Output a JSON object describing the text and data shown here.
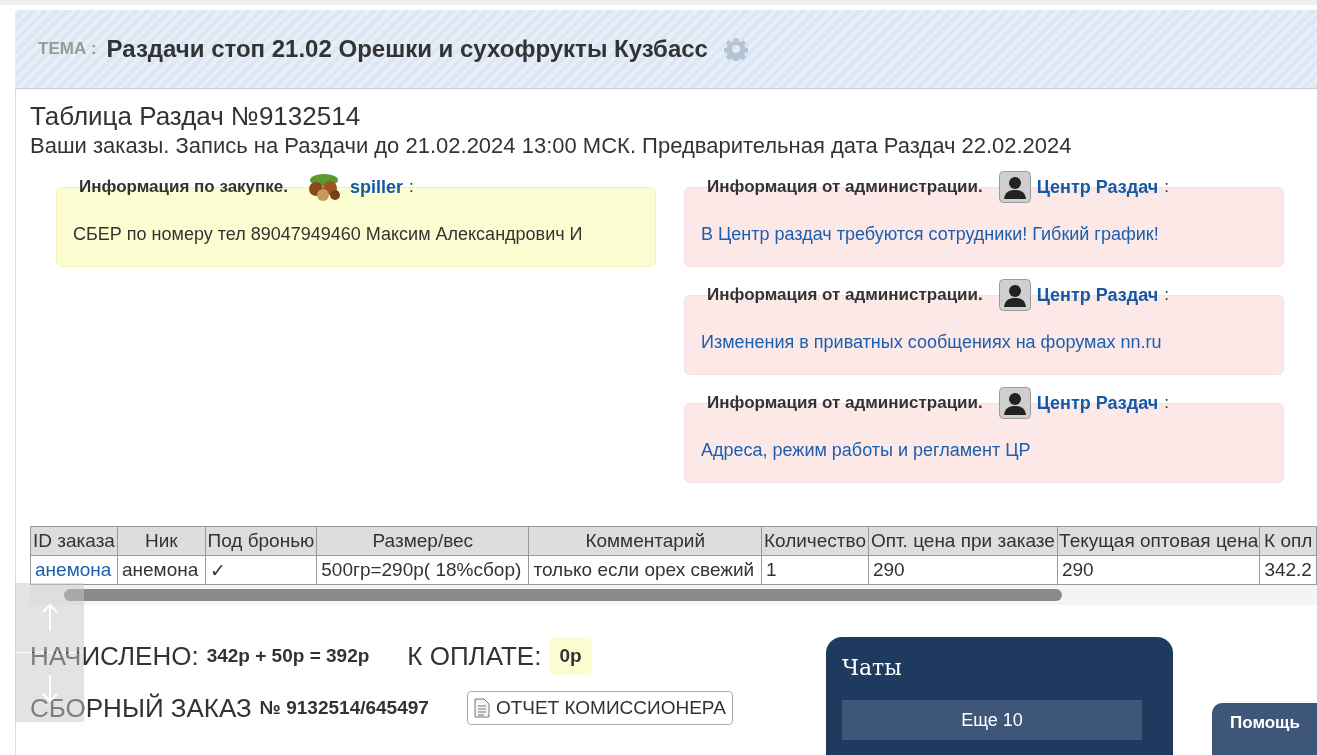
{
  "topic": {
    "label": "ТЕМА :",
    "title": "Раздачи стоп 21.02 Орешки и сухофрукты Кузбасс"
  },
  "table_title": "Таблица Раздач №9132514",
  "subtitle": "Ваши заказы. Запись на Раздачи до 21.02.2024 13:00 МСК. Предварительная дата Раздач 22.02.2024",
  "purchase_info": {
    "heading": "Информация по закупке.",
    "author": "spiller",
    "separator": ":",
    "text": "СБЕР по номеру тел 89047949460 Максим Александрович И"
  },
  "admin_notices": [
    {
      "heading": "Информация от администрации.",
      "author": "Центр Раздач",
      "separator": ":",
      "text": "В Центр раздач требуются сотрудники! Гибкий график!"
    },
    {
      "heading": "Информация от администрации.",
      "author": "Центр Раздач",
      "separator": ":",
      "text": "Изменения в приватных сообщениях на форумах nn.ru"
    },
    {
      "heading": "Информация от администрации.",
      "author": "Центр Раздач",
      "separator": ":",
      "text": "Адреса, режим работы и регламент ЦР"
    }
  ],
  "orders": {
    "columns": [
      "ID заказа",
      "Ник",
      "Под бронью",
      "Размер/вес",
      "Комментарий",
      "Количество",
      "Опт. цена при заказе",
      "Текущая оптовая цена",
      "К опл"
    ],
    "rows": [
      {
        "cells": [
          {
            "kind": "link",
            "text": "анемона"
          },
          {
            "kind": "text",
            "text": "анемона"
          },
          {
            "kind": "text",
            "text": "✓"
          },
          {
            "kind": "text",
            "text": "500гр=290р( 18%сбор)"
          },
          {
            "kind": "text",
            "text": "только если орех свежий"
          },
          {
            "kind": "text",
            "text": "1"
          },
          {
            "kind": "text",
            "text": "290"
          },
          {
            "kind": "text",
            "text": "290"
          },
          {
            "kind": "text",
            "text": "342.2"
          }
        ]
      }
    ]
  },
  "totals": {
    "charged_label": "НАЧИСЛЕНО:",
    "charged_value": "342р + 50р = 392р",
    "to_pay_label": "К ОПЛАТЕ:",
    "to_pay_value": "0р"
  },
  "combined_order": {
    "label": "СБОРНЫЙ ЗАКАЗ",
    "number": "№ 9132514/645497",
    "report_button": "ОТЧЕТ КОМИССИОНЕРА"
  },
  "chats": {
    "title": "Чаты",
    "more_button": "Еще 10"
  },
  "help_button": "Помощь"
}
